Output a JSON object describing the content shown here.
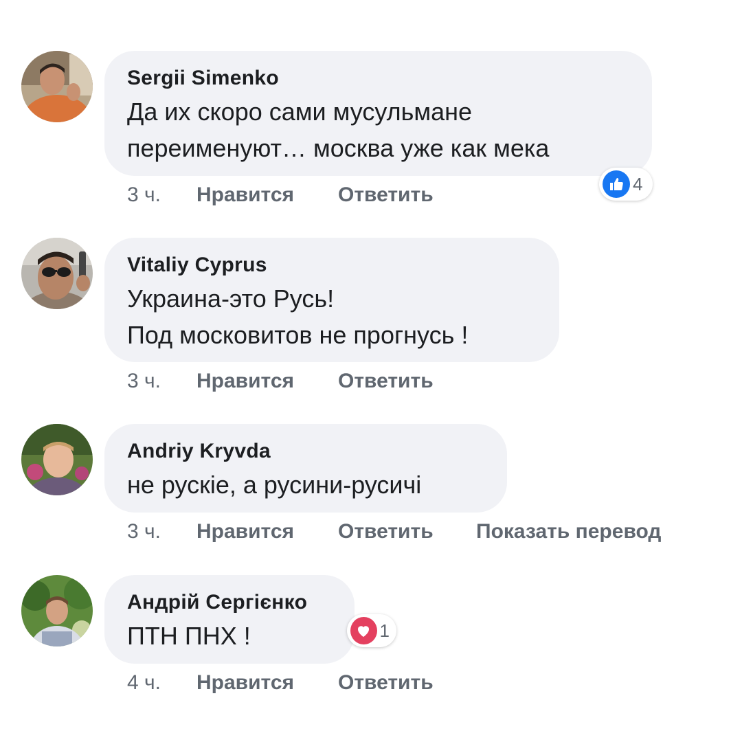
{
  "comments": [
    {
      "author": "Sergii Simenko",
      "text": "Да их скоро сами мусульмане\nпереименуют… москва уже как мека",
      "time": "3 ч.",
      "like_label": "Нравится",
      "reply_label": "Ответить",
      "reaction": {
        "icon": "like-icon",
        "count": "4",
        "color": "#1877f2"
      }
    },
    {
      "author": "Vitaliy Cyprus",
      "text": "Украина-это Русь!\nПод московитов не прогнусь !",
      "time": "3 ч.",
      "like_label": "Нравится",
      "reply_label": "Ответить"
    },
    {
      "author": "Andriy Kryvda",
      "text": "не рускіе, а русини-русичі",
      "time": "3 ч.",
      "like_label": "Нравится",
      "reply_label": "Ответить",
      "translate_label": "Показать перевод"
    },
    {
      "author": "Андрій Сергієнко",
      "text": "ПТН ПНХ !",
      "time": "4 ч.",
      "like_label": "Нравится",
      "reply_label": "Ответить",
      "reaction": {
        "icon": "love-icon",
        "count": "1",
        "color": "#e4405f"
      }
    }
  ]
}
